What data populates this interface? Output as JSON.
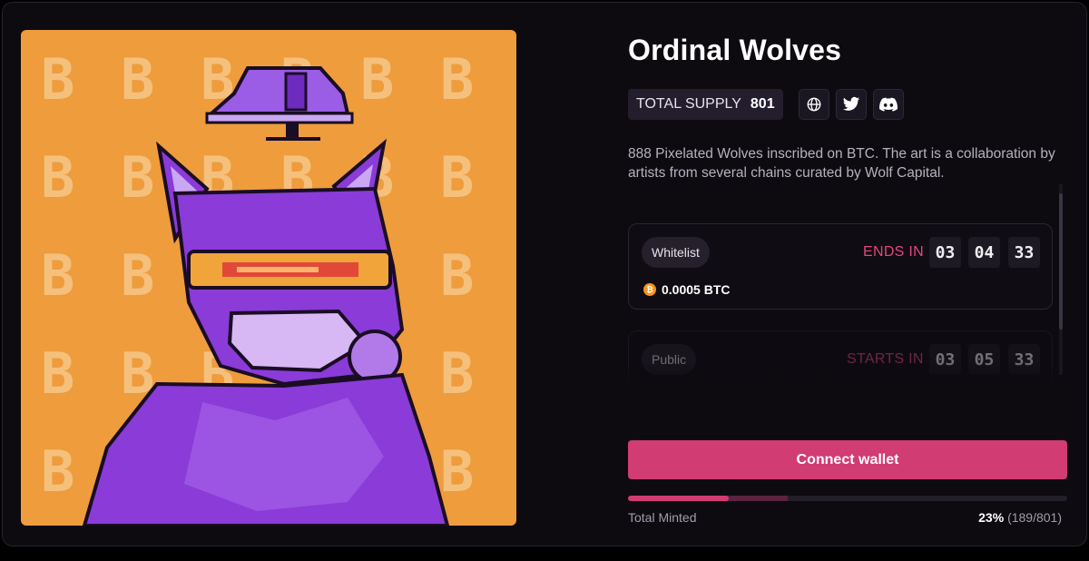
{
  "collection": {
    "title": "Ordinal Wolves",
    "supply_label": "TOTAL SUPPLY",
    "supply_value": "801",
    "description": "888 Pixelated Wolves inscribed on BTC. The art is a collaboration by artists from several chains curated by Wolf Capital."
  },
  "artwork": {
    "background_glyph": "B",
    "background_color": "#ee9c3c",
    "wolf_color": "#8a3bd8"
  },
  "social": [
    {
      "name": "globe-icon"
    },
    {
      "name": "twitter-icon"
    },
    {
      "name": "discord-icon"
    }
  ],
  "phases": [
    {
      "label": "Whitelist",
      "countdown_label": "ENDS IN",
      "hours": "03",
      "minutes": "04",
      "seconds": "33",
      "price": "0.0005 BTC",
      "price_icon": "₿"
    },
    {
      "label": "Public",
      "countdown_label": "STARTS IN",
      "hours": "03",
      "minutes": "05",
      "seconds": "33"
    }
  ],
  "mint": {
    "connect_label": "Connect wallet",
    "total_minted_label": "Total Minted",
    "percent": "23%",
    "count": "(189/801)",
    "progress_fraction": 0.23
  },
  "colors": {
    "accent": "#d13c72",
    "countdown": "#e8457a",
    "background": "#0d0b10"
  }
}
